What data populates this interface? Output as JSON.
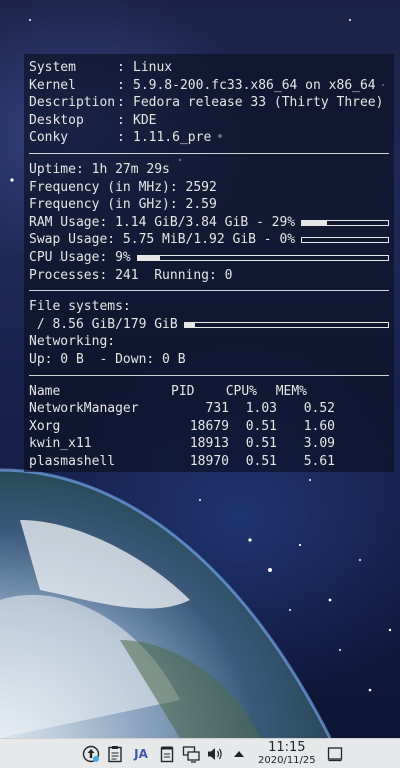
{
  "system": [
    {
      "key": "System",
      "value": "Linux"
    },
    {
      "key": "Kernel",
      "value": "5.9.8-200.fc33.x86_64 on x86_64"
    },
    {
      "key": "Description",
      "value": "Fedora release 33 (Thirty Three)"
    },
    {
      "key": "Desktop",
      "value": "KDE"
    },
    {
      "key": "Conky",
      "value": "1.11.6_pre"
    }
  ],
  "stats": {
    "uptime": "Uptime: 1h 27m 29s",
    "freq_mhz": "Frequency (in MHz): 2592",
    "freq_ghz": "Frequency (in GHz): 2.59",
    "ram": "RAM Usage: 1.14 GiB/3.84 GiB - 29%",
    "ram_fraction": 0.29,
    "swap": "Swap Usage: 5.75 MiB/1.92 GiB - 0%",
    "swap_fraction": 0.0,
    "cpu": "CPU Usage: 9%",
    "cpu_fraction": 0.09,
    "processes": "Processes: 241  Running: 0"
  },
  "filesystems": {
    "title": "File systems:",
    "root": " / 8.56 GiB/179 GiB",
    "root_fraction": 0.05,
    "networking_title": "Networking:",
    "net": "Up: 0 B  - Down: 0 B"
  },
  "process_table": {
    "headers": [
      "Name",
      "PID",
      "CPU%",
      "MEM%"
    ],
    "rows": [
      [
        "NetworkManager",
        "731",
        "1.03",
        "0.52"
      ],
      [
        "Xorg",
        "18679",
        "0.51",
        "1.60"
      ],
      [
        "kwin_x11",
        "18913",
        "0.51",
        "3.09"
      ],
      [
        "plasmashell",
        "18970",
        "0.51",
        "5.61"
      ]
    ]
  },
  "taskbar": {
    "icons": [
      "update-icon",
      "clipboard-icon",
      "input-method-icon",
      "notes-icon",
      "network-icon",
      "volume-icon",
      "expand-tray-icon"
    ],
    "input_method_label": "JA",
    "time": "11:15",
    "date": "2020/11/25",
    "show_desktop": "show-desktop-icon"
  },
  "colors": {
    "text": "#e6e6e6",
    "panel_bg": "#0a0e1e",
    "taskbar_bg": "#e7e8e9"
  }
}
